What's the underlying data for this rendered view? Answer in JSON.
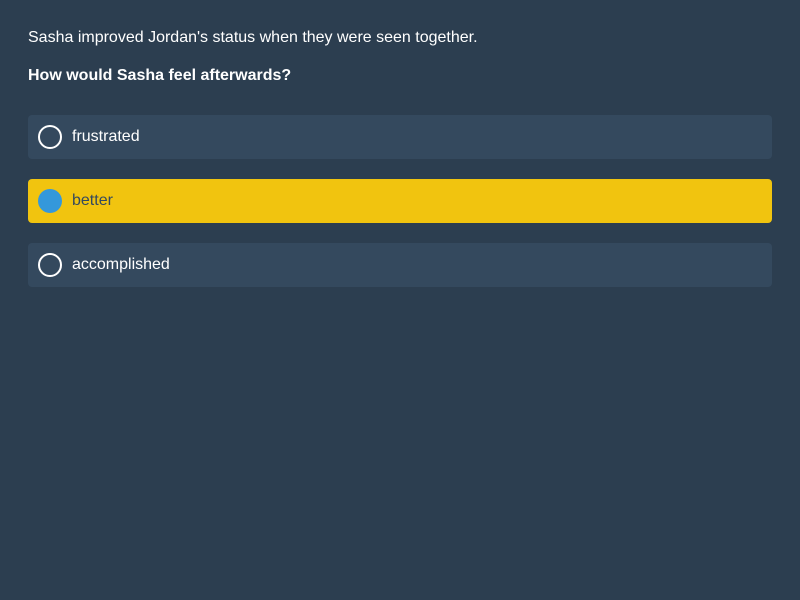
{
  "context": "Sasha improved Jordan's status when they were seen together.",
  "question": "How would Sasha feel afterwards?",
  "options": [
    {
      "label": "frustrated",
      "selected": false
    },
    {
      "label": "better",
      "selected": true
    },
    {
      "label": "accomplished",
      "selected": false
    }
  ],
  "colors": {
    "background": "#2c3e50",
    "option_background": "#34495e",
    "selected_background": "#f1c40f",
    "selected_radio": "#3498db"
  }
}
